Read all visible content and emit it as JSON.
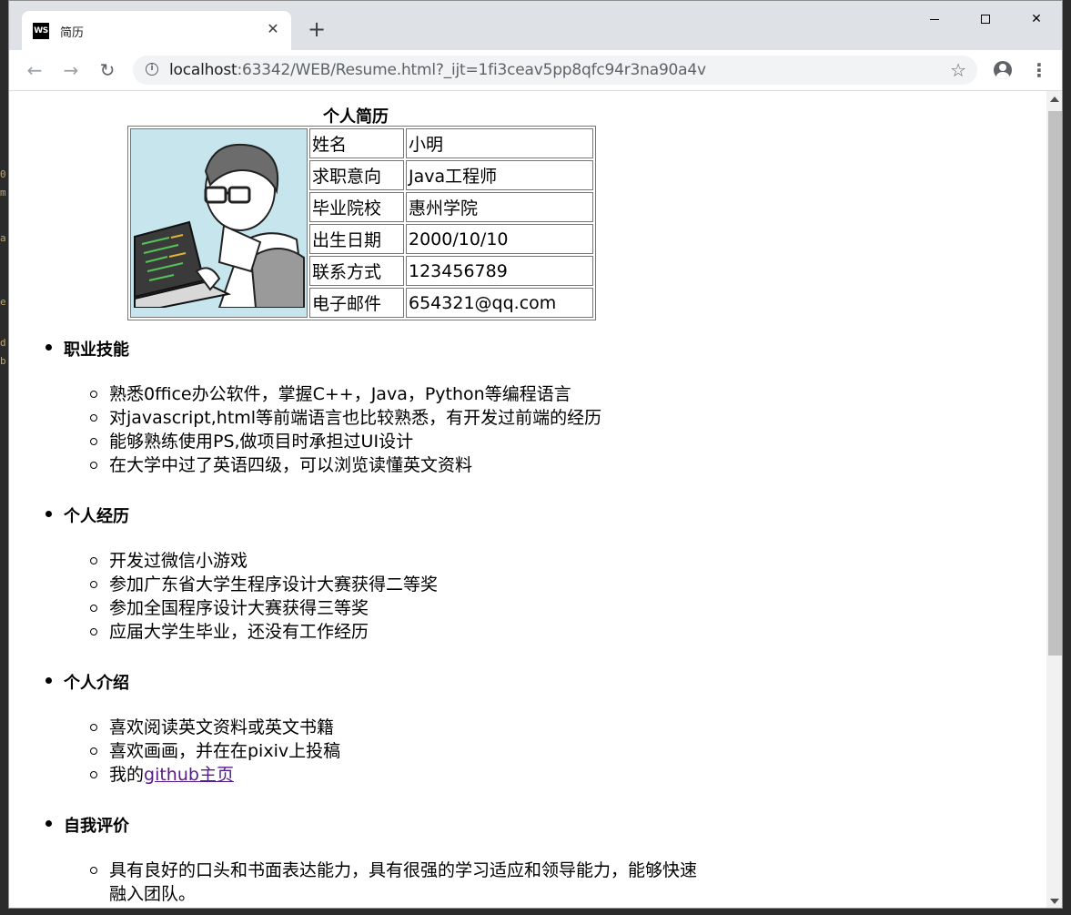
{
  "browser": {
    "tab_title": "简历",
    "tab_favicon": "WS",
    "url_host": "localhost",
    "url_rest": ":63342/WEB/Resume.html?_ijt=1fi3ceav5pp8qfc94r3na90a4v"
  },
  "resume": {
    "caption": "个人简历",
    "rows": [
      {
        "key": "姓名",
        "value": "小明"
      },
      {
        "key": "求职意向",
        "value": "Java工程师"
      },
      {
        "key": "毕业院校",
        "value": "惠州学院"
      },
      {
        "key": "出生日期",
        "value": "2000/10/10"
      },
      {
        "key": "联系方式",
        "value": "123456789"
      },
      {
        "key": "电子邮件",
        "value": "654321@qq.com"
      }
    ]
  },
  "sections": [
    {
      "title": "职业技能",
      "items": [
        "熟悉0ffice办公软件，掌握C++，Java，Python等编程语言",
        "对javascript,html等前端语言也比较熟悉，有开发过前端的经历",
        "能够熟练使用PS,做项目时承担过UI设计",
        "在大学中过了英语四级，可以浏览读懂英文资料"
      ]
    },
    {
      "title": "个人经历",
      "items": [
        "开发过微信小游戏",
        "参加广东省大学生程序设计大赛获得二等奖",
        "参加全国程序设计大赛获得三等奖",
        "应届大学生毕业，还没有工作经历"
      ]
    },
    {
      "title": "个人介绍",
      "items": [
        "喜欢阅读英文资料或英文书籍",
        "喜欢画画，并在在pixiv上投稿"
      ],
      "link_prefix": "我的",
      "link_text": "github主页"
    },
    {
      "title": "自我评价",
      "items": [
        "具有良好的口头和书面表达能力，具有很强的学习适应和领导能力，能够快速融入团队。"
      ]
    }
  ]
}
